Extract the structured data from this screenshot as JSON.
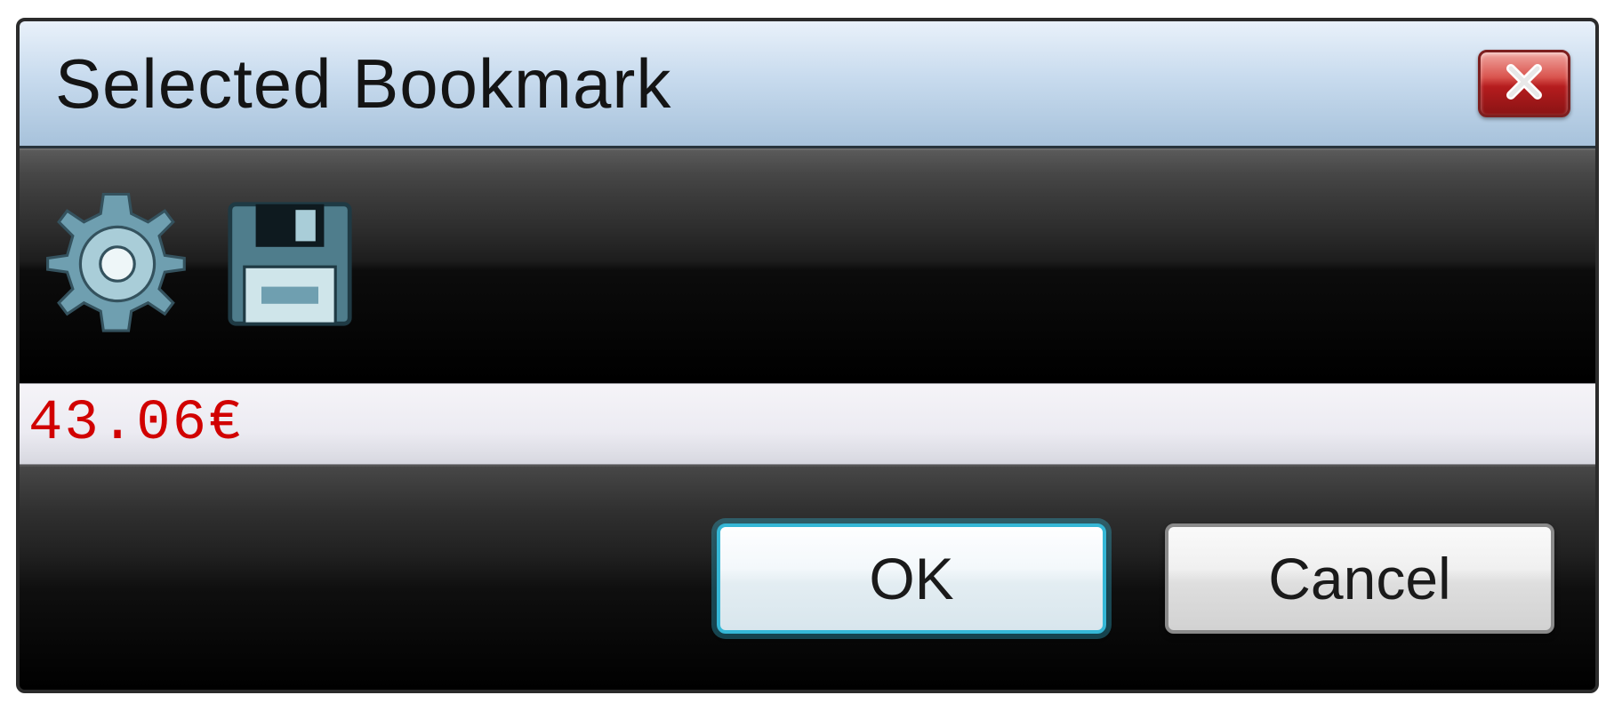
{
  "dialog": {
    "title": "Selected Bookmark",
    "close_icon": "close-icon"
  },
  "toolbar": {
    "gear_icon": "gear-icon",
    "save_icon": "floppy-save-icon"
  },
  "value": {
    "text": "43.06€",
    "color": "#d10000"
  },
  "buttons": {
    "ok_label": "OK",
    "cancel_label": "Cancel"
  },
  "colors": {
    "titlebar_top": "#e9f1fa",
    "titlebar_bottom": "#a7c2db",
    "close_red": "#b51c1e",
    "icon_teal": "#6f9fb0",
    "icon_teal_light": "#a9cdd8",
    "focus_ring": "#35b7d6"
  }
}
